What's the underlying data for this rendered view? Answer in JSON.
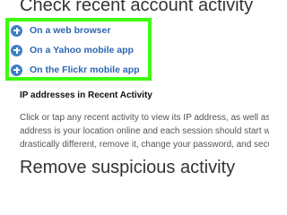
{
  "headings": {
    "check_activity": "Check recent account activity",
    "remove_suspicious": "Remove suspicious activity"
  },
  "activity_links": [
    {
      "label": "On a web browser",
      "icon": "plus-circle-icon"
    },
    {
      "label": "On a Yahoo mobile app",
      "icon": "plus-circle-icon"
    },
    {
      "label": "On the Flickr mobile app",
      "icon": "plus-circle-icon"
    }
  ],
  "ip_section": {
    "title": "IP addresses in Recent Activity",
    "lines": [
      "Click or tap any recent activity to view its IP address, as well as",
      "address is your location online and each session should start wit",
      "drastically different, remove it, change your password, and secu"
    ]
  },
  "colors": {
    "highlight_border": "#3dfc10",
    "link_text": "#2c66b3",
    "icon_fill": "#3f7fc6"
  }
}
